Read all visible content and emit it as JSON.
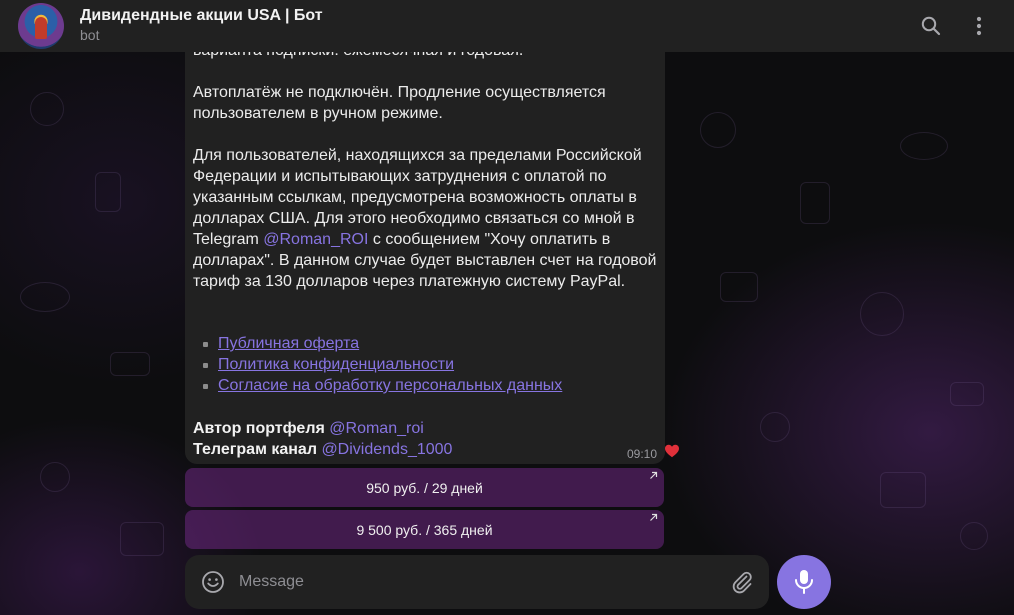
{
  "header": {
    "title": "Дивидендные акции USA | Бот",
    "subtitle": "bot"
  },
  "message": {
    "cut_line": "варианта подписки: ежемесячная и годовая.",
    "para_autopay": "Автоплатёж не подключён. Продление осуществляется пользователем в ручном режиме.",
    "para_foreign_before": "Для пользователей, находящихся за пределами Российской Федерации и испытывающих затруднения с оплатой по указанным ссылкам, предусмотрена возможность оплаты в долларах США. Для этого необходимо связаться со мной в Telegram ",
    "para_foreign_mention": "@Roman_ROI",
    "para_foreign_after": " с сообщением \"Хочу оплатить в долларах\". В данном случае будет выставлен счет на годовой тариф за 130 долларов через платежную систему PayPal.",
    "links": [
      "Публичная оферта",
      "Политика конфиденциальности",
      "Согласие на обработку персональных данных"
    ],
    "author_label": "Автор портфеля",
    "author_mention": "@Roman_roi",
    "channel_label": "Телеграм канал",
    "channel_mention": "@Dividends_1000",
    "time": "09:10",
    "reaction": "heart"
  },
  "keyboard": [
    {
      "label": "950 руб. / 29 дней",
      "icon": "arrow-up-right"
    },
    {
      "label": "9 500 руб. / 365 дней",
      "icon": "arrow-up-right"
    }
  ],
  "composer": {
    "placeholder": "Message",
    "value": ""
  },
  "colors": {
    "accent": "#8774e1",
    "bubble": "#212121",
    "header": "#212121",
    "button_bg": "#5a2a6b",
    "reaction": "#e0303a"
  }
}
